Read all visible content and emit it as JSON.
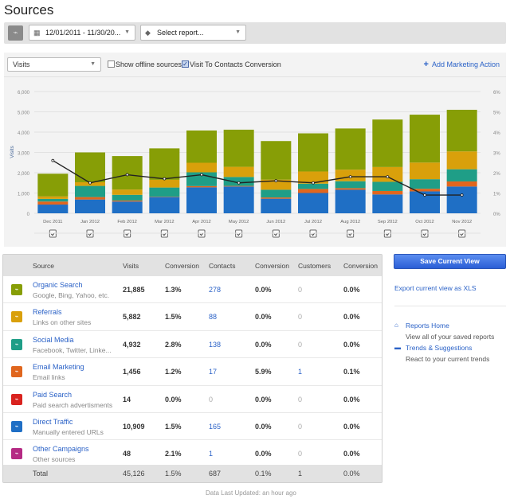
{
  "page_title": "Sources",
  "toolbar": {
    "date_range": "12/01/2011 - 11/30/20...",
    "report_placeholder": "Select report..."
  },
  "chart_controls": {
    "metric": "Visits",
    "show_offline_label": "Show offline sources",
    "show_offline_checked": false,
    "conversion_label": "Visit To Contacts Conversion",
    "conversion_checked": true,
    "add_action": "Add Marketing Action"
  },
  "chart_data": {
    "type": "bar",
    "stacked": true,
    "categories": [
      "Dec 2011",
      "Jan 2012",
      "Feb 2012",
      "Mar 2012",
      "Apr 2012",
      "May 2012",
      "Jun 2012",
      "Jul 2012",
      "Aug 2012",
      "Sep 2012",
      "Oct 2012",
      "Nov 2012"
    ],
    "ylabel": "Visits",
    "ylim": [
      0,
      6000
    ],
    "yticks": [
      "0",
      "1,000",
      "2,000",
      "3,000",
      "4,000",
      "5,000",
      "6,000"
    ],
    "y2lim": [
      0,
      6
    ],
    "y2ticks": [
      "0%",
      "1%",
      "2%",
      "3%",
      "4%",
      "5%",
      "6%"
    ],
    "grid": true,
    "series": [
      {
        "name": "Direct Traffic",
        "color": "#1f6fc5",
        "values": [
          430,
          680,
          580,
          800,
          1280,
          1320,
          720,
          1000,
          1160,
          930,
          1080,
          1320
        ]
      },
      {
        "name": "Email Marketing",
        "color": "#e0661e",
        "values": [
          150,
          120,
          50,
          20,
          60,
          30,
          60,
          200,
          80,
          170,
          130,
          250
        ]
      },
      {
        "name": "Social Media",
        "color": "#1f9e87",
        "values": [
          130,
          550,
          280,
          450,
          680,
          440,
          380,
          260,
          340,
          450,
          470,
          600
        ]
      },
      {
        "name": "Referrals",
        "color": "#d9a00b",
        "values": [
          120,
          180,
          260,
          380,
          470,
          500,
          500,
          600,
          570,
          730,
          820,
          880
        ]
      },
      {
        "name": "Organic Search",
        "color": "#879e06",
        "values": [
          1120,
          1470,
          1650,
          1550,
          1590,
          1830,
          1900,
          1880,
          2030,
          2340,
          2360,
          2050
        ]
      }
    ],
    "line": {
      "name": "Visit To Contacts Conversion",
      "unit": "%",
      "color": "#222222",
      "values": [
        2.6,
        1.5,
        1.9,
        1.7,
        1.9,
        1.5,
        1.6,
        1.5,
        1.8,
        1.8,
        0.9,
        0.9
      ]
    }
  },
  "table": {
    "headers": [
      "Source",
      "Visits",
      "Conversion",
      "Contacts",
      "Conversion",
      "Customers",
      "Conversion"
    ],
    "rows": [
      {
        "name": "Organic Search",
        "sub": "Google, Bing, Yahoo, etc.",
        "color": "#879e06",
        "visits": "21,885",
        "conv1": "1.3%",
        "contacts": "278",
        "conv2": "0.0%",
        "customers": "0",
        "conv3": "0.0%"
      },
      {
        "name": "Referrals",
        "sub": "Links on other sites",
        "color": "#d9a00b",
        "visits": "5,882",
        "conv1": "1.5%",
        "contacts": "88",
        "conv2": "0.0%",
        "customers": "0",
        "conv3": "0.0%"
      },
      {
        "name": "Social Media",
        "sub": "Facebook, Twitter, Linke...",
        "color": "#1f9e87",
        "visits": "4,932",
        "conv1": "2.8%",
        "contacts": "138",
        "conv2": "0.0%",
        "customers": "0",
        "conv3": "0.0%"
      },
      {
        "name": "Email Marketing",
        "sub": "Email links",
        "color": "#e0661e",
        "visits": "1,456",
        "conv1": "1.2%",
        "contacts": "17",
        "conv2": "5.9%",
        "customers": "1",
        "conv3": "0.1%"
      },
      {
        "name": "Paid Search",
        "sub": "Paid search advertisments",
        "color": "#d9231f",
        "visits": "14",
        "conv1": "0.0%",
        "contacts": "0",
        "conv2": "0.0%",
        "customers": "0",
        "conv3": "0.0%"
      },
      {
        "name": "Direct Traffic",
        "sub": "Manually entered URLs",
        "color": "#1f6fc5",
        "visits": "10,909",
        "conv1": "1.5%",
        "contacts": "165",
        "conv2": "0.0%",
        "customers": "0",
        "conv3": "0.0%"
      },
      {
        "name": "Other Campaigns",
        "sub": "Other sources",
        "color": "#b52a84",
        "visits": "48",
        "conv1": "2.1%",
        "contacts": "1",
        "conv2": "0.0%",
        "customers": "0",
        "conv3": "0.0%"
      }
    ],
    "total": {
      "label": "Total",
      "visits": "45,126",
      "conv1": "1.5%",
      "contacts": "687",
      "conv2": "0.1%",
      "customers": "1",
      "conv3": "0.0%"
    }
  },
  "updated": "Data Last Updated: an hour ago",
  "sidebar": {
    "save_button": "Save Current View",
    "export_link": "Export current view as XLS",
    "links": [
      {
        "icon": "home-icon",
        "label": "Reports Home",
        "desc": "View all of your saved reports"
      },
      {
        "icon": "briefcase-icon",
        "label": "Trends & Suggestions",
        "desc": "React to your current trends"
      }
    ]
  }
}
